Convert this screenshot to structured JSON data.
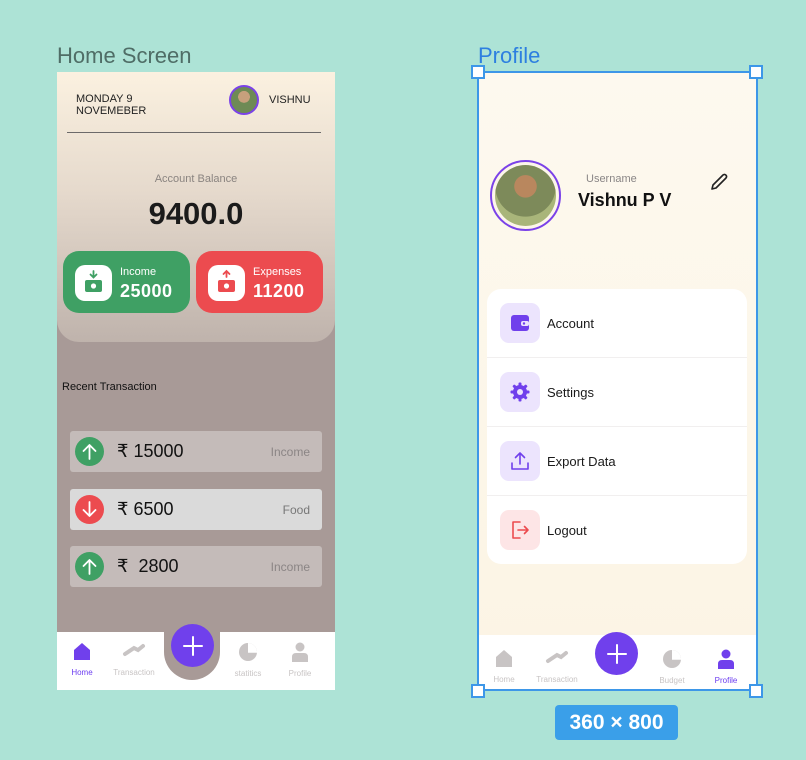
{
  "canvas": {
    "home_frame_label": "Home Screen",
    "profile_frame_label": "Profile",
    "size_badge": "360 × 800",
    "selection_color": "#3d97e8"
  },
  "home": {
    "date_line1": "MONDAY 9",
    "date_line2": "NOVEMEBER",
    "user_name": "VISHNU",
    "balance_label": "Account Balance",
    "balance_value": "9400.0",
    "income": {
      "label": "Income",
      "value": "25000",
      "color": "#3fa064",
      "icon": "income-download-icon"
    },
    "expense": {
      "label": "Expenses",
      "value": "11200",
      "color": "#ec4b4f",
      "icon": "expense-upload-icon"
    },
    "recent_title": "Recent Transaction",
    "transactions": [
      {
        "amount": "₹ 15000",
        "category": "Income",
        "direction": "up"
      },
      {
        "amount": "₹ 6500",
        "category": "Food",
        "direction": "down"
      },
      {
        "amount": "₹  2800",
        "category": "Income",
        "direction": "up"
      }
    ],
    "nav": {
      "home": "Home",
      "transaction": "Transaction",
      "statistics": "statitics",
      "profile": "Profile"
    }
  },
  "profile": {
    "username_label": "Username",
    "name": "Vishnu P V",
    "menu": [
      {
        "label": "Account",
        "icon": "wallet-icon"
      },
      {
        "label": "Settings",
        "icon": "gear-icon"
      },
      {
        "label": "Export Data",
        "icon": "upload-icon"
      },
      {
        "label": "Logout",
        "icon": "logout-icon"
      }
    ],
    "nav": {
      "home": "Home",
      "transaction": "Transaction",
      "budget": "Budget",
      "profile": "Profile"
    },
    "accent": "#7040ec"
  }
}
